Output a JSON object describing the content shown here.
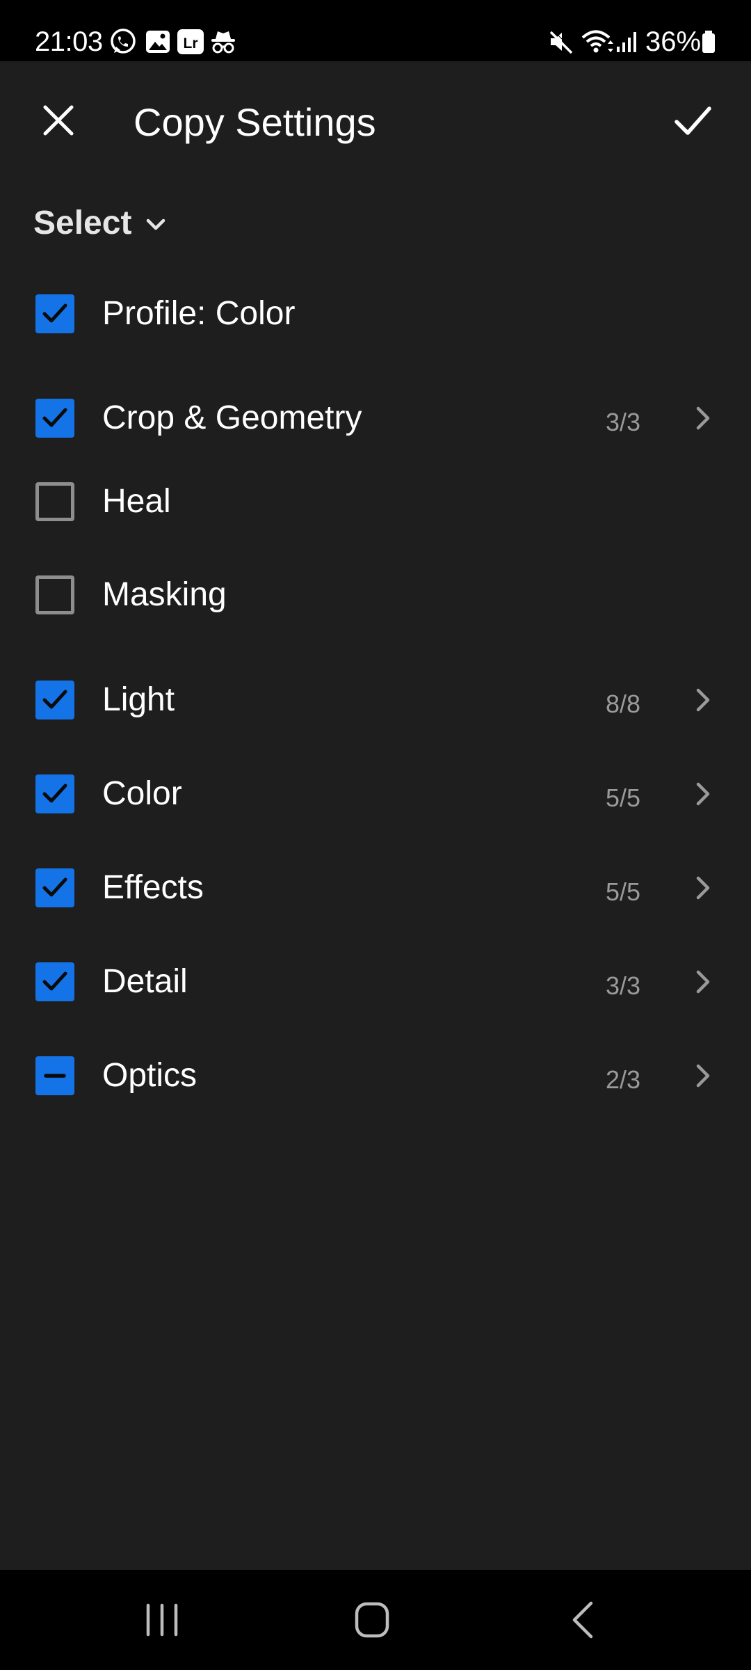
{
  "status_bar": {
    "time": "21:03",
    "left_icons": [
      "whatsapp-icon",
      "gallery-icon",
      "lightroom-icon",
      "incognito-icon"
    ],
    "right_icons": [
      "mute-icon",
      "wifi-icon",
      "signal-icon",
      "battery-icon"
    ],
    "battery": "36%"
  },
  "header": {
    "title": "Copy Settings",
    "close_icon": "close-icon",
    "confirm_icon": "checkmark-icon"
  },
  "select": {
    "label": "Select",
    "icon": "chevron-down-icon"
  },
  "settings": [
    {
      "label": "Profile: Color",
      "state": "checked",
      "count": "",
      "has_chevron": false
    },
    {
      "label": "Crop & Geometry",
      "state": "checked",
      "count": "3/3",
      "has_chevron": true
    },
    {
      "label": "Heal",
      "state": "unchecked",
      "count": "",
      "has_chevron": false
    },
    {
      "label": "Masking",
      "state": "unchecked",
      "count": "",
      "has_chevron": false
    },
    {
      "label": "Light",
      "state": "checked",
      "count": "8/8",
      "has_chevron": true
    },
    {
      "label": "Color",
      "state": "checked",
      "count": "5/5",
      "has_chevron": true
    },
    {
      "label": "Effects",
      "state": "checked",
      "count": "5/5",
      "has_chevron": true
    },
    {
      "label": "Detail",
      "state": "checked",
      "count": "3/3",
      "has_chevron": true
    },
    {
      "label": "Optics",
      "state": "partial",
      "count": "2/3",
      "has_chevron": true
    }
  ],
  "nav_bar": {
    "buttons": [
      "recents-icon",
      "home-icon",
      "back-icon"
    ]
  },
  "colors": {
    "background": "#1e1e1e",
    "bars": "#000000",
    "accent": "#1473e6",
    "text": "#ffffff",
    "muted": "#9a9a9a",
    "unchecked_border": "#8e8e8e"
  }
}
